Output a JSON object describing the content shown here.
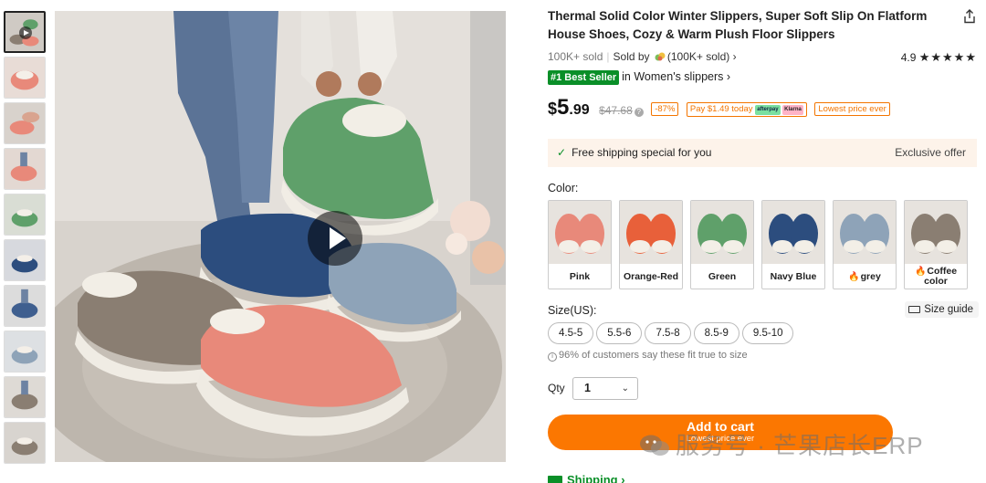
{
  "product": {
    "title": "Thermal Solid Color Winter Slippers, Super Soft Slip On Flatform House Shoes, Cozy & Warm Plush Floor Slippers",
    "sold": "100K+ sold",
    "sold_by_prefix": "Sold by",
    "seller": "(100K+ sold)",
    "seller_chevron": "›",
    "rating": "4.9",
    "stars": "★★★★★",
    "best_badge": "#1 Best Seller",
    "best_category": "in Women's slippers ›",
    "share_icon": "share-icon"
  },
  "price": {
    "currency": "$",
    "integer": "5",
    "decimal": ".99",
    "original": "$47.68",
    "info_glyph": "?",
    "discount": "-87%",
    "installment": "Pay $1.49 today",
    "installment_logo_a": "afterpay",
    "installment_logo_b": "Klarna",
    "lowest": "Lowest price ever",
    "accent_color": "#f37500"
  },
  "shipping_banner": {
    "check": "✓",
    "text": "Free shipping special for you",
    "exclusive": "Exclusive offer"
  },
  "colors": {
    "label": "Color:",
    "options": [
      {
        "label": "Pink",
        "hot": false,
        "shoe": "#e8897a"
      },
      {
        "label": "Orange-Red",
        "hot": false,
        "shoe": "#e8603a"
      },
      {
        "label": "Green",
        "hot": false,
        "shoe": "#5fa06a"
      },
      {
        "label": "Navy Blue",
        "hot": false,
        "shoe": "#2c4d7e"
      },
      {
        "label": "grey",
        "hot": true,
        "shoe": "#8ea3b8"
      },
      {
        "label": "Coffee color",
        "hot": true,
        "shoe": "#8a7e72"
      }
    ],
    "hot_glyph": "🔥"
  },
  "sizes": {
    "label": "Size(US):",
    "guide": "Size guide",
    "options": [
      "4.5-5",
      "5.5-6",
      "7.5-8",
      "8.5-9",
      "9.5-10"
    ],
    "fit_note": "96% of customers say these fit true to size",
    "info_glyph": "i"
  },
  "quantity": {
    "label": "Qty",
    "value": "1",
    "chevron": "⌄"
  },
  "cart": {
    "label": "Add to cart",
    "sub": "Lowest price ever"
  },
  "shipping": {
    "label": "Shipping ›"
  },
  "watermark": {
    "text": "服务号 · 芒果店长ERP"
  }
}
